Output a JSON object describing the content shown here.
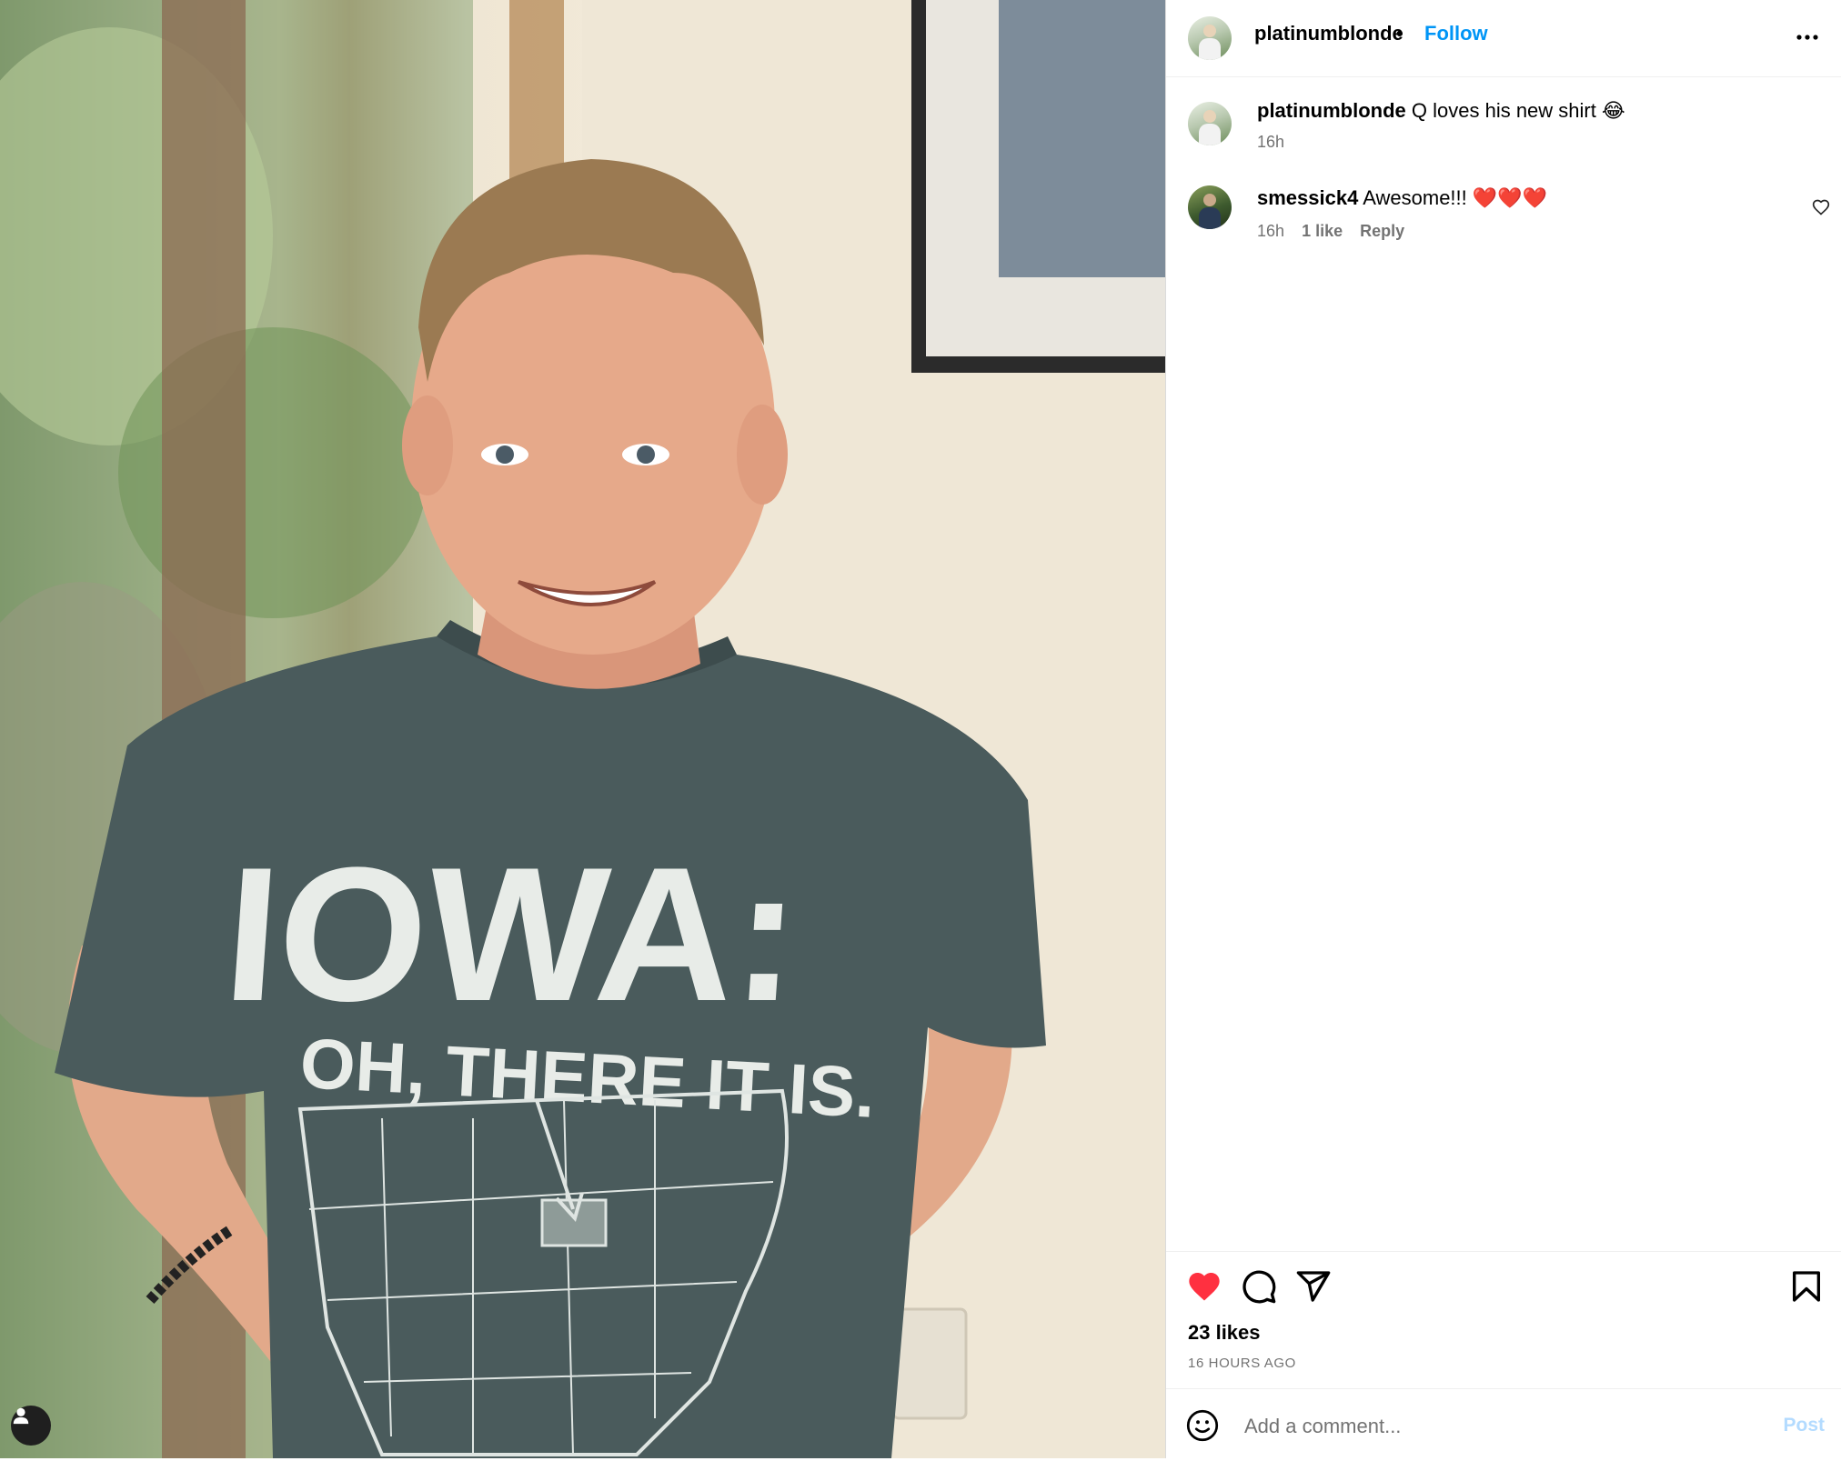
{
  "post": {
    "author": "platinumblonde",
    "separator": "•",
    "follow_label": "Follow",
    "shirt_text_line1": "IOWA:",
    "shirt_text_line2": "OH, THERE IT IS."
  },
  "caption": {
    "username": "platinumblonde",
    "text": "Q loves his new shirt 😂",
    "time": "16h"
  },
  "comments": [
    {
      "username": "smessick4",
      "text": "Awesome!!! ❤️❤️❤️",
      "time": "16h",
      "likes": "1 like",
      "reply_label": "Reply"
    }
  ],
  "actions": {
    "likes": "23 likes",
    "timestamp": "16 HOURS AGO"
  },
  "composer": {
    "placeholder": "Add a comment...",
    "post_label": "Post"
  },
  "colors": {
    "accent": "#0095f6",
    "liked_heart": "#ff3040",
    "post_disabled": "#b3dbff"
  },
  "icons": [
    "more-options-icon",
    "heart-icon",
    "comment-icon",
    "share-icon",
    "bookmark-icon",
    "emoji-icon",
    "user-tag-icon"
  ]
}
